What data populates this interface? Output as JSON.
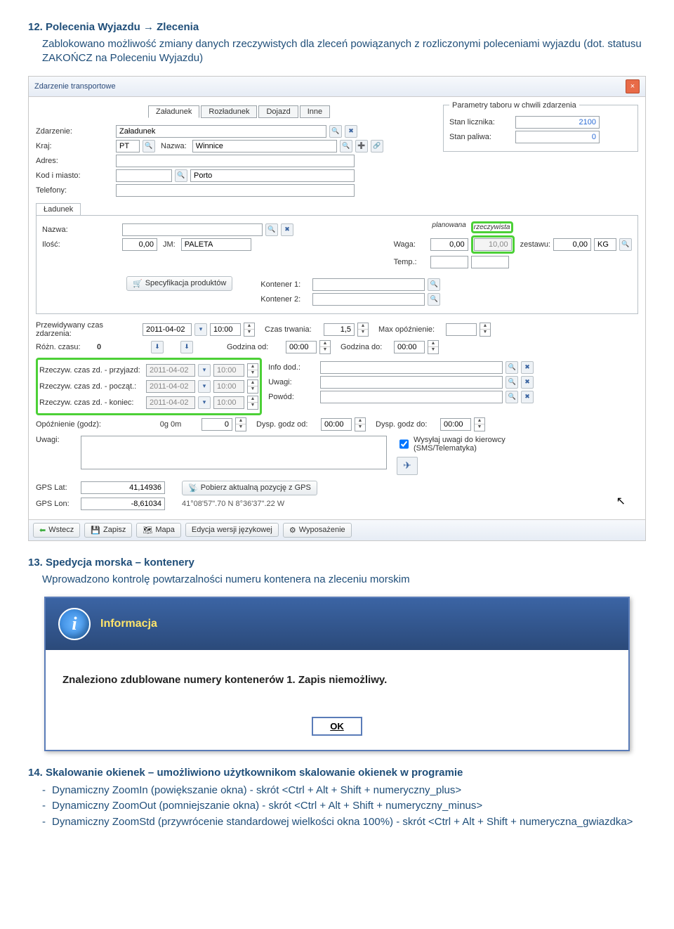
{
  "sec12": {
    "heading_num": "12.",
    "heading_title": "Polecenia Wyjazdu → Zlecenia",
    "desc": "Zablokowano możliwość zmiany danych rzeczywistych dla zleceń powiązanych z rozliczonymi poleceniami wyjazdu (dot. statusu ZAKOŃCZ na Poleceniu Wyjazdu)"
  },
  "dialog1": {
    "title": "Zdarzenie transportowe",
    "tabs": {
      "a": "Załadunek",
      "b": "Rozładunek",
      "c": "Dojazd",
      "d": "Inne"
    },
    "grp_params": "Parametry taboru w chwili zdarzenia",
    "zdarzenie_lbl": "Zdarzenie:",
    "zdarzenie_val": "Załadunek",
    "kraj_lbl": "Kraj:",
    "kraj_val": "PT",
    "nazwa_lbl": "Nazwa:",
    "nazwa_val": "Winnice",
    "adres_lbl": "Adres:",
    "kod_lbl": "Kod i miasto:",
    "kod_city": "Porto",
    "tel_lbl": "Telefony:",
    "stan_licz_lbl": "Stan licznika:",
    "stan_licz_val": "2100",
    "stan_pal_lbl": "Stan paliwa:",
    "stan_pal_val": "0",
    "tab_ladunek": "Ładunek",
    "l_nazwa_lbl": "Nazwa:",
    "l_ilosc_lbl": "Ilość:",
    "l_ilosc_val": "0,00",
    "l_jm_lbl": "JM:",
    "l_jm_val": "PALETA",
    "waga_lbl": "Waga:",
    "waga_plan_lbl": "planowana",
    "waga_rz_lbl": "rzeczywista",
    "waga_plan": "0,00",
    "waga_rz": "10,00",
    "zestawu_lbl": "zestawu:",
    "zestawu_val": "0,00",
    "zestawu_unit": "KG",
    "temp_lbl": "Temp.:",
    "spec_btn": "Specyfikacja produktów",
    "kont1_lbl": "Kontener 1:",
    "kont2_lbl": "Kontener 2:",
    "przew_lbl": "Przewidywany czas zdarzenia:",
    "przew_date": "2011-04-02",
    "przew_time": "10:00",
    "czas_trw_lbl": "Czas trwania:",
    "czas_trw_val": "1,5",
    "max_op_lbl": "Max opóźnienie:",
    "rozn_lbl": "Różn. czasu:",
    "rozn_val": "0",
    "godz_od_lbl": "Godzina od:",
    "godz_od_val": "00:00",
    "godz_do_lbl": "Godzina do:",
    "godz_do_val": "00:00",
    "rz_przy_lbl": "Rzeczyw. czas zd. - przyjazd:",
    "rz_pocz_lbl": "Rzeczyw. czas zd. - począt.:",
    "rz_kon_lbl": "Rzeczyw. czas zd. - koniec:",
    "rz_date": "2011-04-02",
    "rz_time": "10:00",
    "info_dod_lbl": "Info dod.:",
    "uwagi_lbl": "Uwagi:",
    "powod_lbl": "Powód:",
    "opozn_lbl": "Opóźnienie (godz):",
    "opozn_txt": "0g 0m",
    "opozn_val": "0",
    "dysp_od_lbl": "Dysp. godz od:",
    "dysp_od_val": "00:00",
    "dysp_do_lbl": "Dysp. godz do:",
    "dysp_do_val": "00:00",
    "uwagi2_lbl": "Uwagi:",
    "wysyl_lbl": "Wysyłaj uwagi do kierowcy (SMS/Telematyka)",
    "gps_lat_lbl": "GPS Lat:",
    "gps_lat_val": "41,14936",
    "gps_lon_lbl": "GPS Lon:",
    "gps_lon_val": "-8,61034",
    "gps_btn": "Pobierz aktualną pozycję z GPS",
    "gps_txt": "41°08'57\".70 N  8°36'37\".22 W",
    "tb_wstecz": "Wstecz",
    "tb_zapisz": "Zapisz",
    "tb_mapa": "Mapa",
    "tb_edycja": "Edycja wersji językowej",
    "tb_wypos": "Wyposażenie"
  },
  "sec13": {
    "heading_num": "13.",
    "heading_title": "Spedycja morska – kontenery",
    "desc": "Wprowadzono kontrolę powtarzalności numeru kontenera na zleceniu morskim"
  },
  "info": {
    "title": "Informacja",
    "msg": "Znaleziono zdublowane numery kontenerów 1. Zapis niemożliwy.",
    "ok": "OK"
  },
  "sec14": {
    "heading_num": "14.",
    "heading_title": "Skalowanie okienek – umożliwiono użytkownikom skalowanie okienek w programie",
    "li1": "Dynamiczny ZoomIn (powiększanie okna) - skrót <Ctrl + Alt + Shift + numeryczny_plus>",
    "li2": "Dynamiczny ZoomOut (pomniejszanie okna) - skrót <Ctrl + Alt + Shift + numeryczny_minus>",
    "li3": "Dynamiczny ZoomStd (przywrócenie standardowej wielkości okna 100%) - skrót <Ctrl + Alt + Shift + numeryczna_gwiazdka>"
  }
}
